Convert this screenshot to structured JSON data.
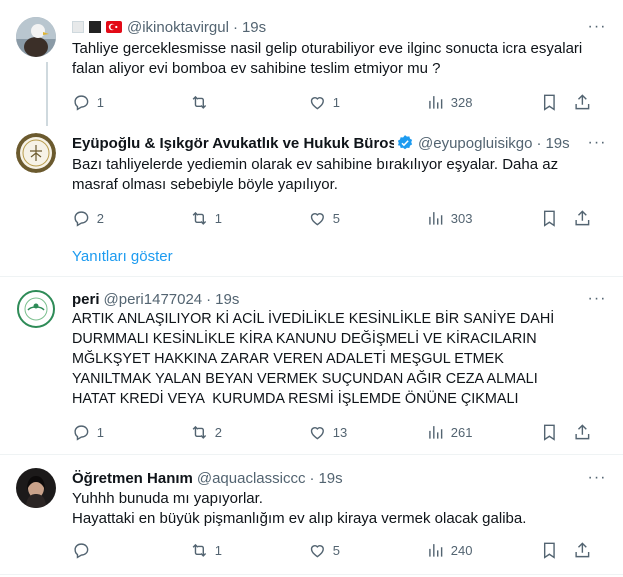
{
  "tweets": [
    {
      "name": "",
      "handle": "@ikinoktavirgul",
      "time": "19s",
      "text": "Tahliye gerceklesmisse nasil gelip oturabiliyor eve ilginc sonucta icra esyalari falan aliyor evi bomboa ev sahibine teslim etmiyor mu ?",
      "replies": "1",
      "retweets": "",
      "likes": "1",
      "views": "328"
    },
    {
      "name": "Eyüpoğlu & Işıkgör Avukatlık ve Hukuk Bürosu",
      "handle": "@eyupogluisikgo",
      "time": "19s",
      "text": "Bazı tahliyelerde yediemin olarak ev sahibine bırakılıyor eşyalar. Daha az masraf olması sebebiyle böyle yapılıyor.",
      "replies": "2",
      "retweets": "1",
      "likes": "5",
      "views": "303"
    },
    {
      "name": "peri",
      "handle": "@peri1477024",
      "time": "19s",
      "text": "ARTIK ANLAŞILIYOR Kİ ACİL İVEDİLİKLE KESİNLİKLE BİR SANİYE DAHİ DURMMALI KESİNLİKLE KİRA KANUNU DEĞİŞMELİ VE KİRACILARIN MĞLKŞYET HAKKINA ZARAR VEREN ADALETİ MEŞGUL ETMEK YANILTMAK YALAN BEYAN VERMEK SUÇUNDAN AĞIR CEZA ALMALI HATAT KREDİ VEYA  KURUMDA RESMİ İŞLEMDE ÖNÜNE ÇIKMALI",
      "replies": "1",
      "retweets": "2",
      "likes": "13",
      "views": "261"
    },
    {
      "name": "Öğretmen Hanım",
      "handle": "@aquaclassiccc",
      "time": "19s",
      "text": "Yuhhh bunuda mı yapıyorlar.\nHayattaki en büyük pişmanlığım ev alıp kiraya vermek olacak galiba.",
      "replies": "",
      "retweets": "1",
      "likes": "5",
      "views": "240"
    }
  ],
  "show_replies_label": "Yanıtları göster",
  "more_label": "···",
  "colors": {
    "accent": "#1d9bf0",
    "muted": "#536471",
    "text": "#0f1419",
    "border": "#eff3f4",
    "thread": "#cfd9de"
  }
}
